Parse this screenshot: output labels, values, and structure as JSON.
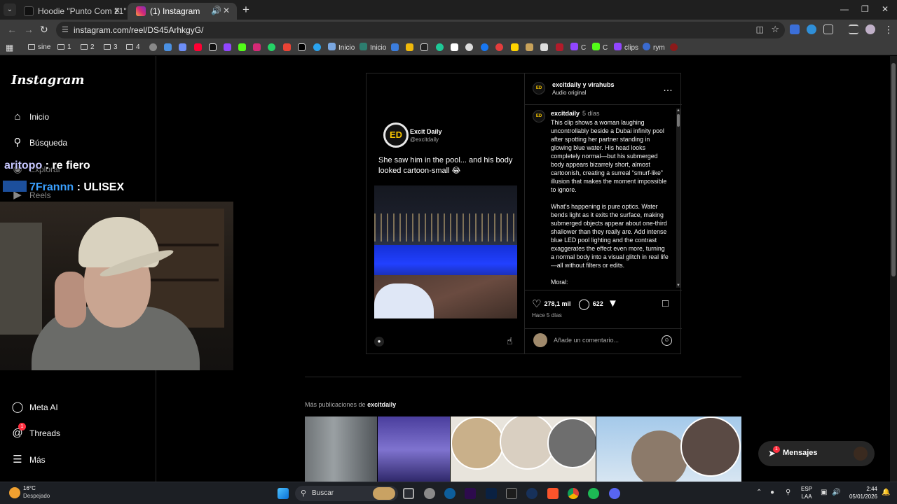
{
  "browser": {
    "tabs": [
      {
        "title": "Hoodie \"Punto Com 21\" (Marró",
        "active": false
      },
      {
        "title": "(1) Instagram",
        "active": true
      }
    ],
    "url": "instagram.com/reel/DS45ArhkgyG/",
    "bookmarks": {
      "folders": [
        "sine",
        "1",
        "2",
        "3",
        "4"
      ],
      "labels": [
        "Inicio",
        "Inicio",
        "C",
        "C",
        "clips",
        "rym"
      ]
    }
  },
  "sidebar": {
    "logo": "Instagram",
    "items": [
      {
        "label": "Inicio",
        "icon": "home-icon"
      },
      {
        "label": "Búsqueda",
        "icon": "search-icon"
      },
      {
        "label": "Explorar",
        "icon": "compass-icon"
      },
      {
        "label": "Reels",
        "icon": "reels-icon"
      },
      {
        "label": "Meta AI",
        "icon": "meta-ai-icon"
      },
      {
        "label": "Threads",
        "icon": "threads-icon",
        "badge": "1"
      },
      {
        "label": "Más",
        "icon": "menu-icon"
      }
    ]
  },
  "stream_overlay": {
    "chat": [
      {
        "user": "aritopo",
        "message": "re fiero"
      },
      {
        "user": "7Frannn",
        "message": "ULISEX"
      }
    ]
  },
  "reel": {
    "channel_initials": "ED",
    "channel_name": "Excit Daily",
    "channel_handle": "@excitdaily",
    "caption": "She saw him in the pool... and his body looked cartoon-small 😂"
  },
  "post": {
    "author_line": "excitdaily y virahubs",
    "audio": "Audio original",
    "author_initials": "ED",
    "comment_user": "excitdaily",
    "comment_date": "5 días",
    "comment_paragraphs": [
      "This clip shows a woman laughing uncontrollably beside a Dubai infinity pool after spotting her partner standing in glowing blue water. His head looks completely normal—but his submerged body appears bizarrely short, almost cartoonish, creating a surreal “smurf-like” illusion that makes the moment impossible to ignore.",
      "What’s happening is pure optics. Water bends light as it exits the surface, making submerged objects appear about one-third shallower than they really are. Add intense blue LED pool lighting and the contrast exaggerates the effect even more, turning a normal body into a visual glitch in real life—all without filters or edits.",
      "Moral:"
    ],
    "likes": "278,1 mil",
    "comments": "622",
    "posted_ago": "Hace 5 días",
    "comment_placeholder": "Añade un comentario..."
  },
  "more_posts": {
    "prefix": "Más publicaciones de",
    "user": "excitdaily"
  },
  "messages": {
    "label": "Mensajes",
    "badge": "1"
  },
  "taskbar": {
    "temperature": "16°C",
    "weather": "Despejado",
    "search_label": "Buscar",
    "lang_top": "ESP",
    "lang_bottom": "LAA",
    "time": "2:44",
    "date": "05/01/2026"
  },
  "colors": {
    "accent_blue": "#0095f6",
    "badge_red": "#ff3040",
    "page_bg": "#000000"
  }
}
